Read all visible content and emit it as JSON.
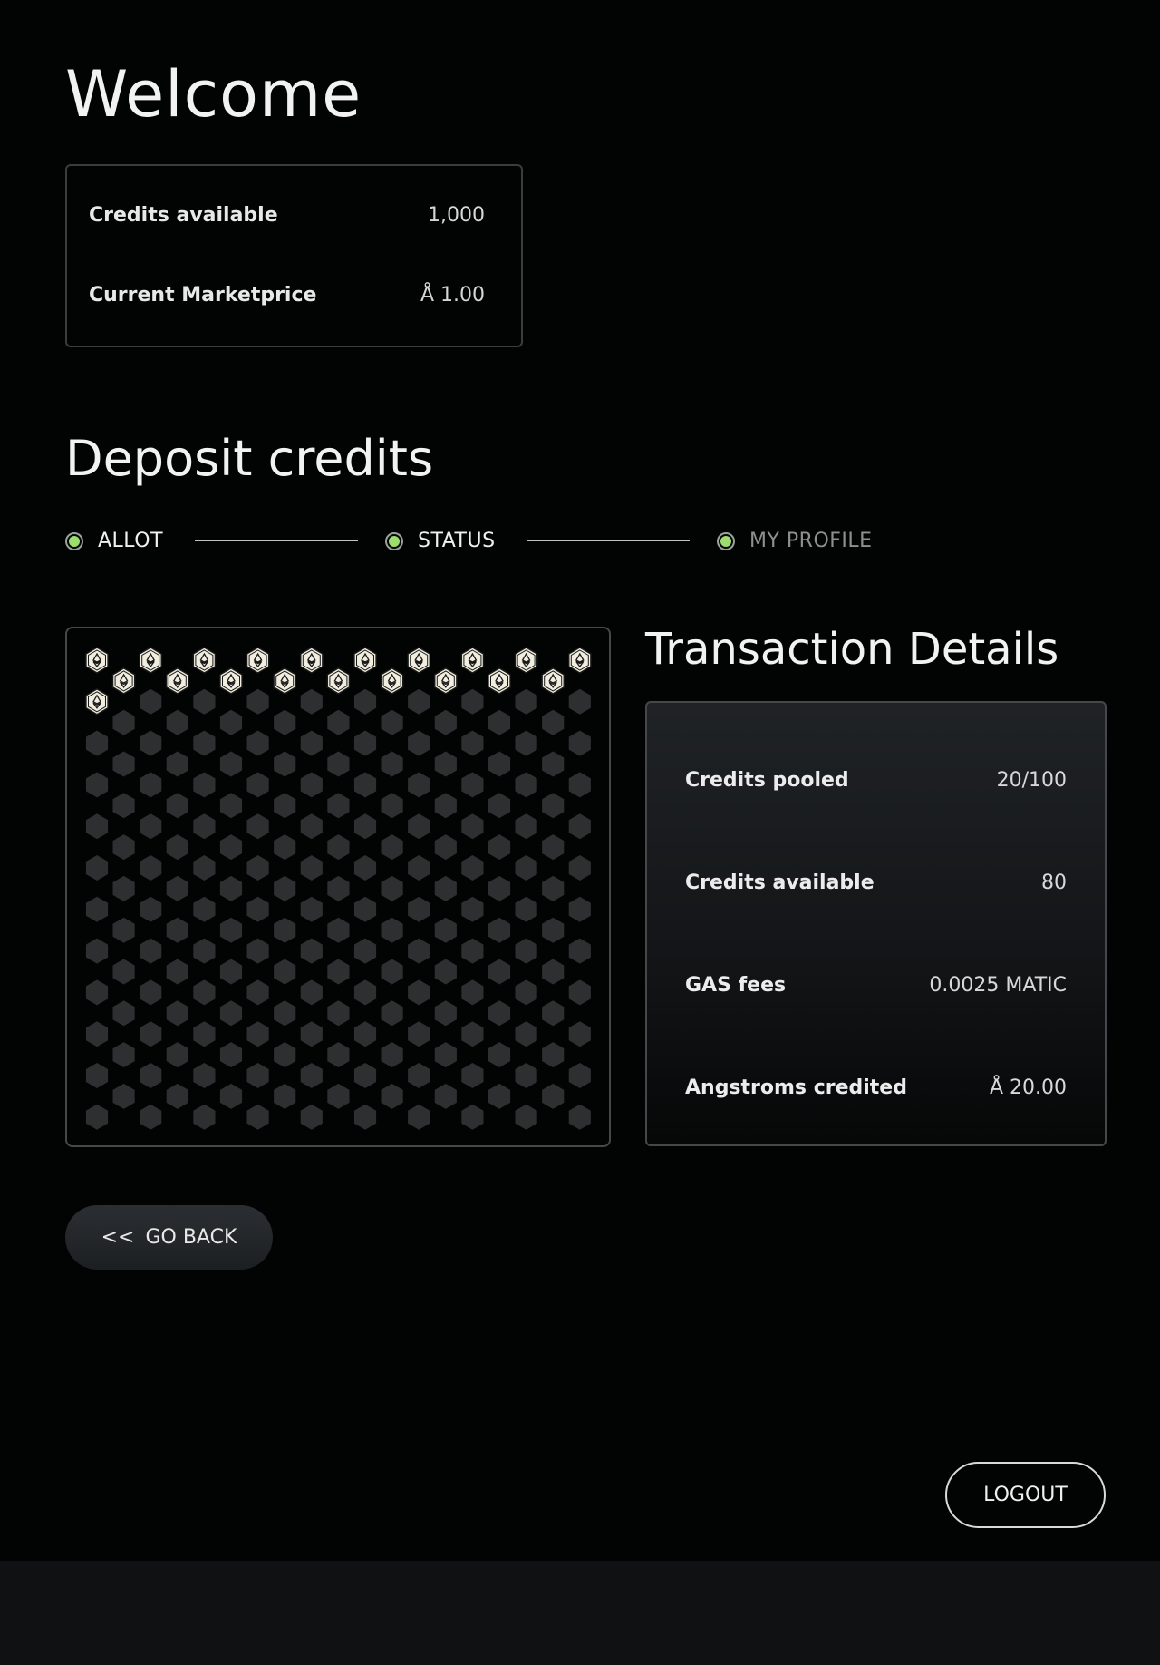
{
  "welcome": {
    "title": "Welcome",
    "credits_available_label": "Credits available",
    "credits_available_value": "1,000",
    "marketprice_label": "Current Marketprice",
    "marketprice_value": "Å 1.00"
  },
  "deposit": {
    "title": "Deposit credits",
    "steps": [
      {
        "label": "ALLOT",
        "state": "active"
      },
      {
        "label": "STATUS",
        "state": "active"
      },
      {
        "label": "MY PROFILE",
        "state": "dim"
      }
    ]
  },
  "hex_grid": {
    "filled_count": 20,
    "total_count": 234,
    "filled_color": "#f1eedf",
    "empty_color": "#2d2f31",
    "filled_icon": "ethereum-icon"
  },
  "transaction": {
    "title": "Transaction Details",
    "rows": [
      {
        "label": "Credits pooled",
        "value": "20/100"
      },
      {
        "label": "Credits available",
        "value": "80"
      },
      {
        "label": "GAS fees",
        "value": "0.0025 MATIC"
      },
      {
        "label": "Angstroms credited",
        "value": "Å 20.00"
      }
    ]
  },
  "buttons": {
    "back_arrows": "<<",
    "back_label": "GO BACK",
    "logout_label": "LOGOUT"
  },
  "colors": {
    "accent_green": "#9ddc6e",
    "background": "#020303",
    "footer": "#0f1113"
  }
}
